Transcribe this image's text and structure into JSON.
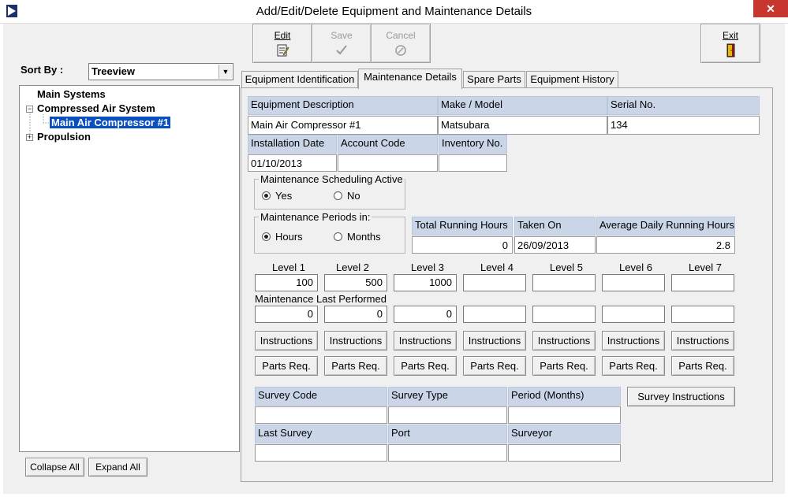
{
  "window": {
    "title": "Add/Edit/Delete Equipment and Maintenance Details",
    "close_glyph": "✕"
  },
  "toolbar": {
    "edit": {
      "label": "Edit",
      "icon": "edit-doc-icon",
      "enabled": true
    },
    "save": {
      "label": "Save",
      "icon": "checkmark-icon",
      "enabled": false
    },
    "cancel": {
      "label": "Cancel",
      "icon": "cancel-icon",
      "enabled": false
    },
    "exit": {
      "label": "Exit",
      "icon": "exit-door-icon",
      "enabled": true
    }
  },
  "left_pane": {
    "sort_by_label": "Sort By :",
    "sort_by_value": "Treeview",
    "tree": [
      {
        "label": "Main Systems",
        "expander": ""
      },
      {
        "label": "Compressed Air System",
        "expander": "−"
      },
      {
        "label": "Main Air Compressor #1",
        "expander": "",
        "selected": true
      },
      {
        "label": "Propulsion",
        "expander": "+"
      }
    ],
    "collapse_all_label": "Collapse All",
    "expand_all_label": "Expand All"
  },
  "tabs": [
    {
      "label": "Equipment Identification",
      "active": false
    },
    {
      "label": "Maintenance Details",
      "active": true
    },
    {
      "label": "Spare Parts",
      "active": false
    },
    {
      "label": "Equipment History",
      "active": false
    }
  ],
  "equipment": {
    "description_header": "Equipment Description",
    "description_value": "Main Air Compressor #1",
    "make_model_header": "Make / Model",
    "make_model_value": "Matsubara",
    "serial_header": "Serial No.",
    "serial_value": "134",
    "installation_date_header": "Installation Date",
    "installation_date_value": "01/10/2013",
    "account_code_header": "Account Code",
    "account_code_value": "",
    "inventory_no_header": "Inventory No.",
    "inventory_no_value": ""
  },
  "scheduling": {
    "title": "Maintenance Scheduling Active",
    "yes_label": "Yes",
    "no_label": "No",
    "selected": "Yes"
  },
  "periods": {
    "title": "Maintenance Periods in:",
    "hours_label": "Hours",
    "months_label": "Months",
    "selected": "Hours"
  },
  "running": {
    "total_hours_header": "Total Running Hours",
    "total_hours_value": "0",
    "taken_on_header": "Taken On",
    "taken_on_value": "26/09/2013",
    "avg_daily_header": "Average Daily Running Hours",
    "avg_daily_value": "2.8"
  },
  "levels": {
    "labels": [
      "Level 1",
      "Level 2",
      "Level 3",
      "Level 4",
      "Level 5",
      "Level 6",
      "Level 7"
    ],
    "intervals": [
      "100",
      "500",
      "1000",
      "",
      "",
      "",
      ""
    ],
    "last_performed_label": "Maintenance Last Performed",
    "last_performed": [
      "0",
      "0",
      "0",
      "",
      "",
      "",
      ""
    ],
    "instructions_label": "Instructions",
    "parts_req_label": "Parts Req."
  },
  "survey": {
    "code_header": "Survey Code",
    "type_header": "Survey Type",
    "period_header": "Period (Months)",
    "last_survey_header": "Last Survey",
    "port_header": "Port",
    "surveyor_header": "Surveyor",
    "code_value": "",
    "type_value": "",
    "period_value": "",
    "last_survey_value": "",
    "port_value": "",
    "surveyor_value": "",
    "instructions_button": "Survey Instructions"
  },
  "colors": {
    "header_bg": "#cad6e8",
    "selection": "#0a4fbf",
    "close_button": "#c7372f"
  }
}
